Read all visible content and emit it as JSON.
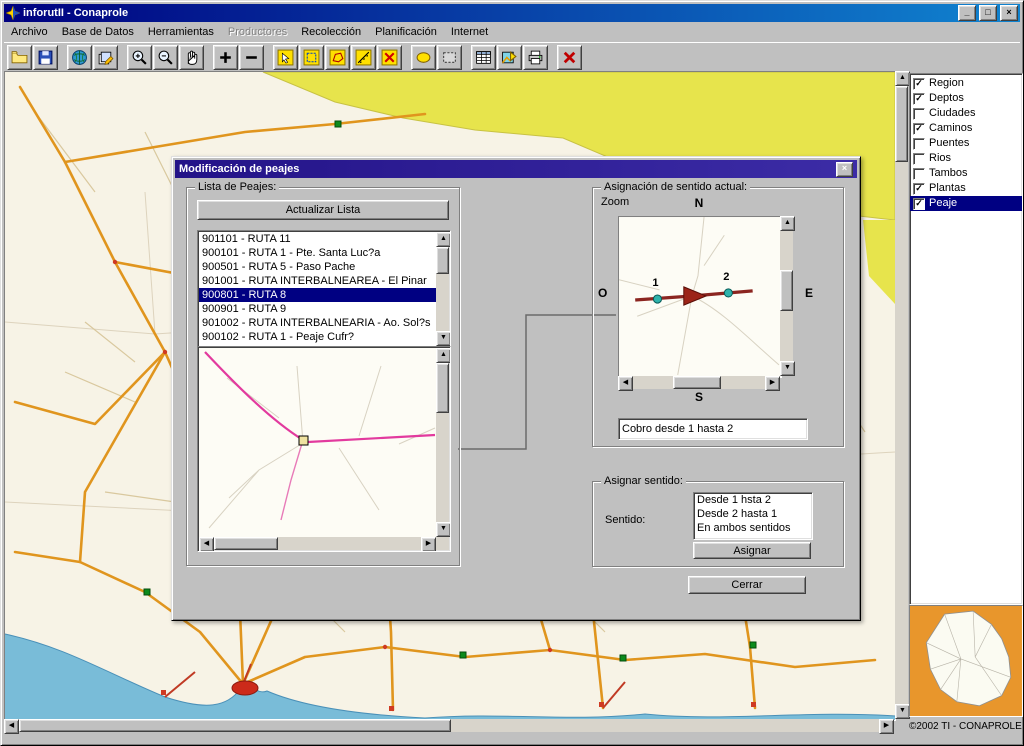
{
  "window": {
    "title": "inforutII - Conaprole",
    "controls": {
      "minimize": "_",
      "maximize": "□",
      "close": "×"
    }
  },
  "menu": {
    "items": [
      {
        "label": "Archivo",
        "enabled": true
      },
      {
        "label": "Base de Datos",
        "enabled": true
      },
      {
        "label": "Herramientas",
        "enabled": true
      },
      {
        "label": "Productores",
        "enabled": false
      },
      {
        "label": "Recolección",
        "enabled": true
      },
      {
        "label": "Planificación",
        "enabled": true
      },
      {
        "label": "Internet",
        "enabled": true
      }
    ]
  },
  "toolbar": {
    "buttons": [
      "open-folder-icon",
      "save-icon",
      "sep",
      "globe-icon",
      "edit-layers-icon",
      "sep",
      "zoom-in-icon",
      "zoom-out-icon",
      "pan-hand-icon",
      "sep",
      "plus-icon",
      "minus-icon",
      "sep",
      "select-rect-icon",
      "select-area-icon",
      "select-polygon-icon",
      "measure-icon",
      "clear-selection-icon",
      "sep",
      "highlight-icon",
      "marquee-icon",
      "sep",
      "table-icon",
      "map-export-icon",
      "print-icon",
      "sep",
      "delete-x-icon"
    ]
  },
  "layers": {
    "items": [
      {
        "label": "Region",
        "checked": true,
        "selected": false
      },
      {
        "label": "Deptos",
        "checked": true,
        "selected": false
      },
      {
        "label": "Ciudades",
        "checked": false,
        "selected": false
      },
      {
        "label": "Caminos",
        "checked": true,
        "selected": false
      },
      {
        "label": "Puentes",
        "checked": false,
        "selected": false
      },
      {
        "label": "Rios",
        "checked": false,
        "selected": false
      },
      {
        "label": "Tambos",
        "checked": false,
        "selected": false
      },
      {
        "label": "Plantas",
        "checked": true,
        "selected": false
      },
      {
        "label": "Peaje",
        "checked": true,
        "selected": true
      }
    ]
  },
  "copyright": "©2002 TI - CONAPROLE",
  "dialog": {
    "title": "Modificación de peajes",
    "close": "×",
    "groups": {
      "lista": "Lista de Peajes:",
      "asignacion": "Asignación de sentido actual:",
      "asignar": "Asignar sentido:"
    },
    "actualizar_button": "Actualizar Lista",
    "peajes": [
      {
        "text": "901101 - RUTA 11",
        "selected": false
      },
      {
        "text": "900101 - RUTA 1 - Pte. Santa Luc?a",
        "selected": false
      },
      {
        "text": "900501 - RUTA 5 - Paso Pache",
        "selected": false
      },
      {
        "text": "901001 - RUTA INTERBALNEAREA - El Pinar",
        "selected": false
      },
      {
        "text": "900801 - RUTA 8",
        "selected": true
      },
      {
        "text": "900901 - RUTA 9",
        "selected": false
      },
      {
        "text": "901002 - RUTA INTERBALNEARIA - Ao. Sol?s",
        "selected": false
      },
      {
        "text": "900102 - RUTA 1 - Peaje Cufr?",
        "selected": false
      }
    ],
    "zoom_label": "Zoom",
    "compass": {
      "n": "N",
      "s": "S",
      "e": "E",
      "o": "O"
    },
    "point1": "1",
    "point2": "2",
    "cobro_text": "Cobro desde 1 hasta 2",
    "sentido_label": "Sentido:",
    "sentido_options": [
      {
        "text": "Desde 1 hsta 2",
        "selected": false
      },
      {
        "text": "Desde 2 hasta 1",
        "selected": false
      },
      {
        "text": "En ambos sentidos",
        "selected": false
      }
    ],
    "asignar_button": "Asignar",
    "cerrar_button": "Cerrar"
  },
  "colors": {
    "selection": "#000082",
    "dialog_title": "#2a1a8e",
    "map_yellow": "#e7e44c",
    "water": "#79bcd8",
    "road_major": "#e0951e",
    "road_pink": "#e23a9e",
    "toll_road": "#8b2520",
    "marker_teal": "#2fb3ac"
  }
}
